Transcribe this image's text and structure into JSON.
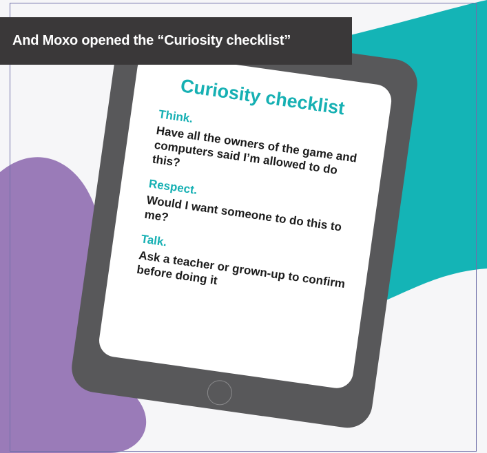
{
  "caption": "And Moxo opened the “Curiosity checklist”",
  "tablet": {
    "title": "Curiosity checklist",
    "items": [
      {
        "heading": "Think.",
        "body": "Have all the owners of the game and computers said I’m allowed to do this?"
      },
      {
        "heading": "Respect.",
        "body": "Would I want someone to do this to me?"
      },
      {
        "heading": "Talk.",
        "body": "Ask a teacher or grown-up to confirm before doing it"
      }
    ]
  },
  "colors": {
    "teal": "#16b0b3",
    "purple": "#9a7bb8",
    "caption_bg": "#3a3839",
    "tablet_body": "#58585a"
  }
}
